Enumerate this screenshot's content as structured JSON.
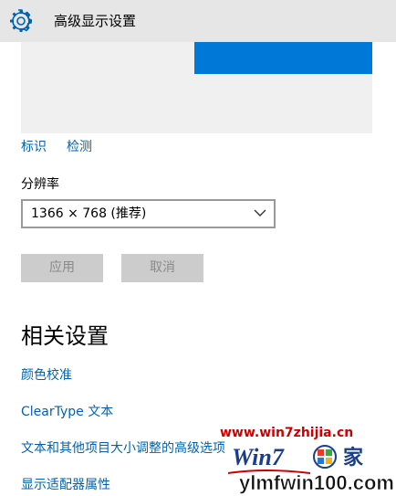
{
  "header": {
    "title": "高级显示设置"
  },
  "display_links": {
    "identify": "标识",
    "detect": "检测"
  },
  "resolution": {
    "label": "分辨率",
    "selected": "1366 × 768 (推荐)"
  },
  "buttons": {
    "apply": "应用",
    "cancel": "取消"
  },
  "related": {
    "title": "相关设置",
    "links": [
      "颜色校准",
      "ClearType 文本",
      "文本和其他项目大小调整的高级选项",
      "显示适配器属性"
    ]
  },
  "watermark": {
    "url": "www.win7zhijia.cn",
    "logo_text": "Win7",
    "site_text": "ylmfwin100.com"
  },
  "colors": {
    "titlebar": "#e6e6e6",
    "accent": "#0078d7",
    "link": "#0063b1",
    "disabled_button": "#cccccc"
  },
  "icons": {
    "settings": "gear-icon",
    "dropdown": "chevron-down-icon"
  }
}
